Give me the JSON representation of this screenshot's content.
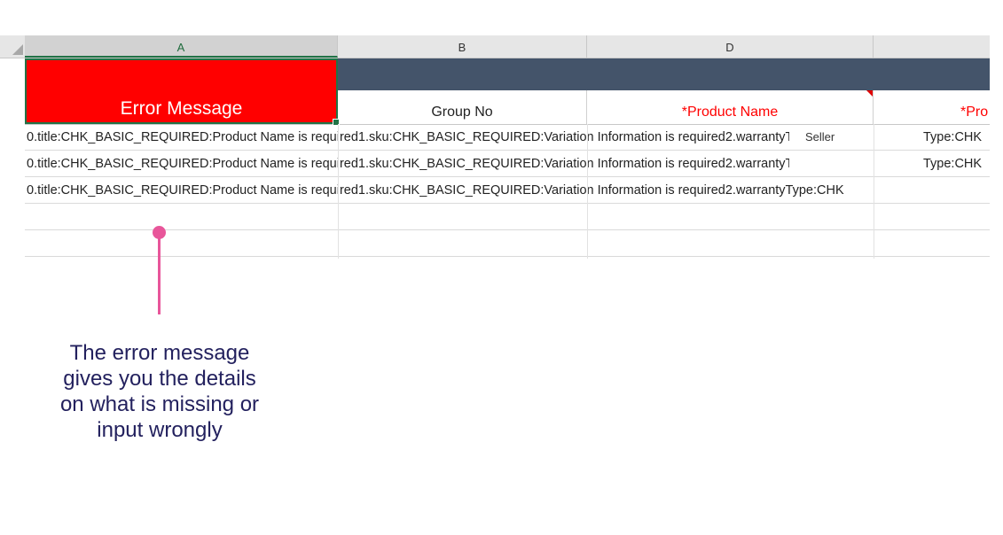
{
  "columns": {
    "a": "A",
    "b": "B",
    "d": "D"
  },
  "headers": {
    "error_message": "Error Message",
    "group_no": "Group No",
    "product_name": "*Product Name",
    "partial": "*Pro"
  },
  "rows": [
    {
      "text": "0.title:CHK_BASIC_REQUIRED:Product Name is required1.sku:CHK_BASIC_REQUIRED:Variation Information is required2.warrantyType:CHK",
      "overlay": "Seller",
      "tail": "Type:CHK"
    },
    {
      "text": "0.title:CHK_BASIC_REQUIRED:Product Name is required1.sku:CHK_BASIC_REQUIRED:Variation Information is required2.warrantyType:CHK",
      "overlay": "",
      "tail": "Type:CHK"
    },
    {
      "text": "0.title:CHK_BASIC_REQUIRED:Product Name is required1.sku:CHK_BASIC_REQUIRED:Variation Information is required2.warrantyType:CHK"
    }
  ],
  "annotation": "The error message gives you the details on what is missing or input wrongly",
  "colors": {
    "error_fill": "#ff0000",
    "banner": "#44546a",
    "pin": "#e8569a",
    "annotation_text": "#23215e"
  }
}
